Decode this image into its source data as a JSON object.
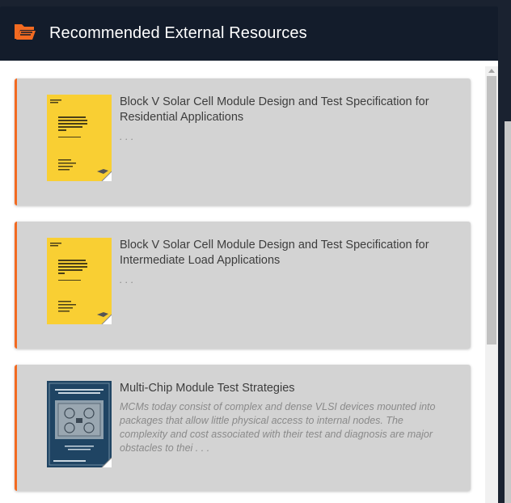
{
  "header": {
    "title": "Recommended External Resources",
    "icon": "folder-open-icon",
    "accent_color": "#f26a21"
  },
  "resources": [
    {
      "title": "Block V Solar Cell Module Design and Test Specification for Residential Applications",
      "description": ". . .",
      "cover": "yellow-document-cover"
    },
    {
      "title": "Block V Solar Cell Module Design and Test Specification for Intermediate Load Applications",
      "description": ". . .",
      "cover": "yellow-document-cover"
    },
    {
      "title": "Multi-Chip Module Test Strategies",
      "description": "MCMs today consist of complex and dense VLSI devices mounted into packages that allow little physical access to internal nodes. The complexity and cost associated with their test and diagnosis are major obstacles to thei . . .",
      "cover": "blue-book-cover"
    }
  ],
  "colors": {
    "header_bg": "#131c2b",
    "card_bg": "#d3d3d3",
    "card_accent": "#f26a21"
  }
}
